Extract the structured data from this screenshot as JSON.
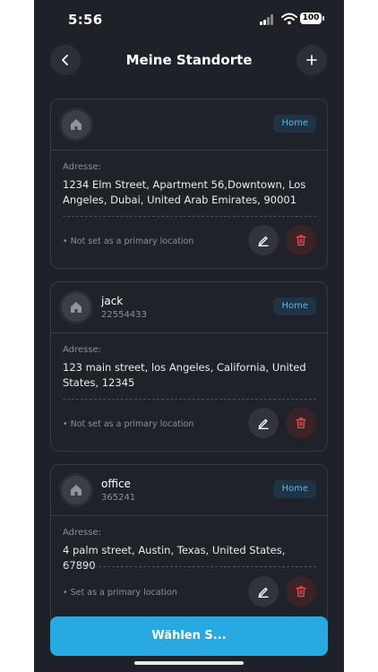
{
  "status_bar": {
    "time": "5:56",
    "battery": "100"
  },
  "header": {
    "title": "Meine Standorte"
  },
  "address_label": "Adresse:",
  "locations": [
    {
      "name": "",
      "phone": "",
      "badge": "Home",
      "address": "1234 Elm Street, Apartment 56,Downtown, Los Angeles, Dubai, United Arab Emirates, 90001",
      "primary_status": "• Not set as a primary location"
    },
    {
      "name": "jack",
      "phone": "22554433",
      "badge": "Home",
      "address": "123 main street, los Angeles, California, United States, 12345",
      "primary_status": "• Not set as a primary location"
    },
    {
      "name": "office",
      "phone": "365241",
      "badge": "Home",
      "address": "4 palm street, Austin, Texas, United States, 67890",
      "primary_status": "• Set as a primary location"
    }
  ],
  "select_button": "Wählen S...",
  "colors": {
    "background": "#1e2128",
    "accent": "#29a9e1",
    "badge_text": "#5fb4e6",
    "delete": "#e0534f"
  },
  "icons": {
    "back": "chevron-left-icon",
    "add": "plus-icon",
    "avatar": "home-icon",
    "edit": "pencil-icon",
    "delete": "trash-icon"
  }
}
